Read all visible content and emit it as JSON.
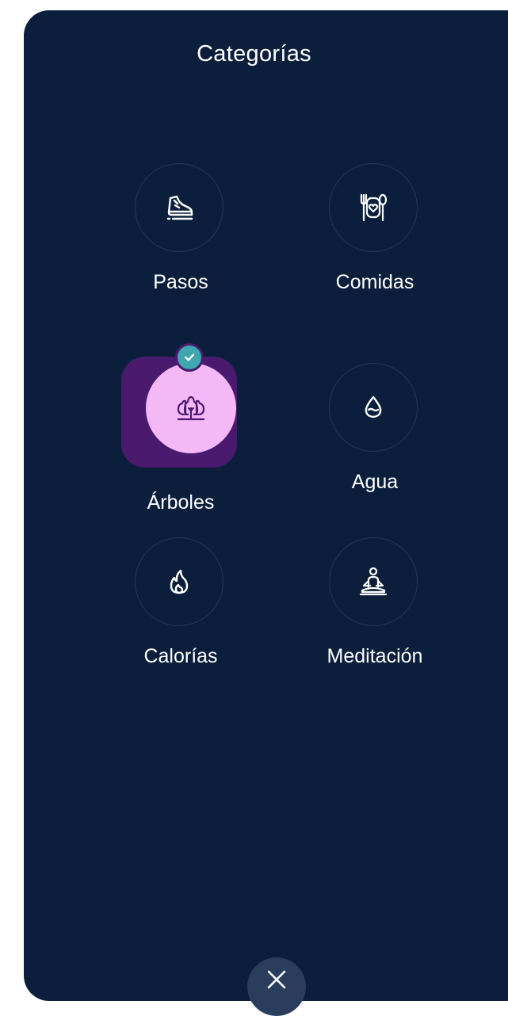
{
  "header": {
    "title": "Categorías"
  },
  "categories": [
    {
      "label": "Pasos",
      "icon": "shoe-icon",
      "selected": false
    },
    {
      "label": "Comidas",
      "icon": "plate-cutlery-icon",
      "selected": false
    },
    {
      "label": "Árboles",
      "icon": "trees-icon",
      "selected": true
    },
    {
      "label": "Agua",
      "icon": "water-drop-icon",
      "selected": false
    },
    {
      "label": "Calorías",
      "icon": "flame-icon",
      "selected": false
    },
    {
      "label": "Meditación",
      "icon": "meditation-icon",
      "selected": false
    }
  ],
  "colors": {
    "panel_background": "#0b1f3d",
    "selected_halo": "#4a1a6e",
    "selected_circle": "#f5b8f7",
    "check_badge": "#3fa7b0",
    "close_button": "#2b3d5c"
  },
  "footer": {
    "close_icon": "close-icon"
  }
}
